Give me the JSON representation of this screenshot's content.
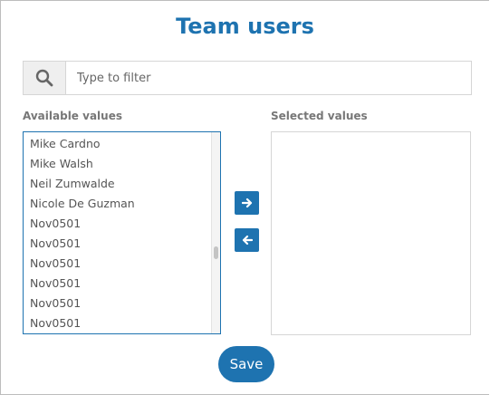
{
  "dialog": {
    "title": "Team users",
    "filter": {
      "placeholder": "Type to filter",
      "icon": "search-icon"
    },
    "available": {
      "label": "Available values",
      "items": [
        "Mike Cardno",
        "Mike Walsh",
        "Neil Zumwalde",
        "Nicole De Guzman",
        "Nov0501",
        "Nov0501",
        "Nov0501",
        "Nov0501",
        "Nov0501",
        "Nov0501"
      ]
    },
    "selected": {
      "label": "Selected values",
      "items": []
    },
    "buttons": {
      "move_right_icon": "arrow-right-icon",
      "move_left_icon": "arrow-left-icon",
      "save": "Save"
    },
    "colors": {
      "accent": "#1e73b0",
      "border": "#d6d6d6"
    }
  }
}
